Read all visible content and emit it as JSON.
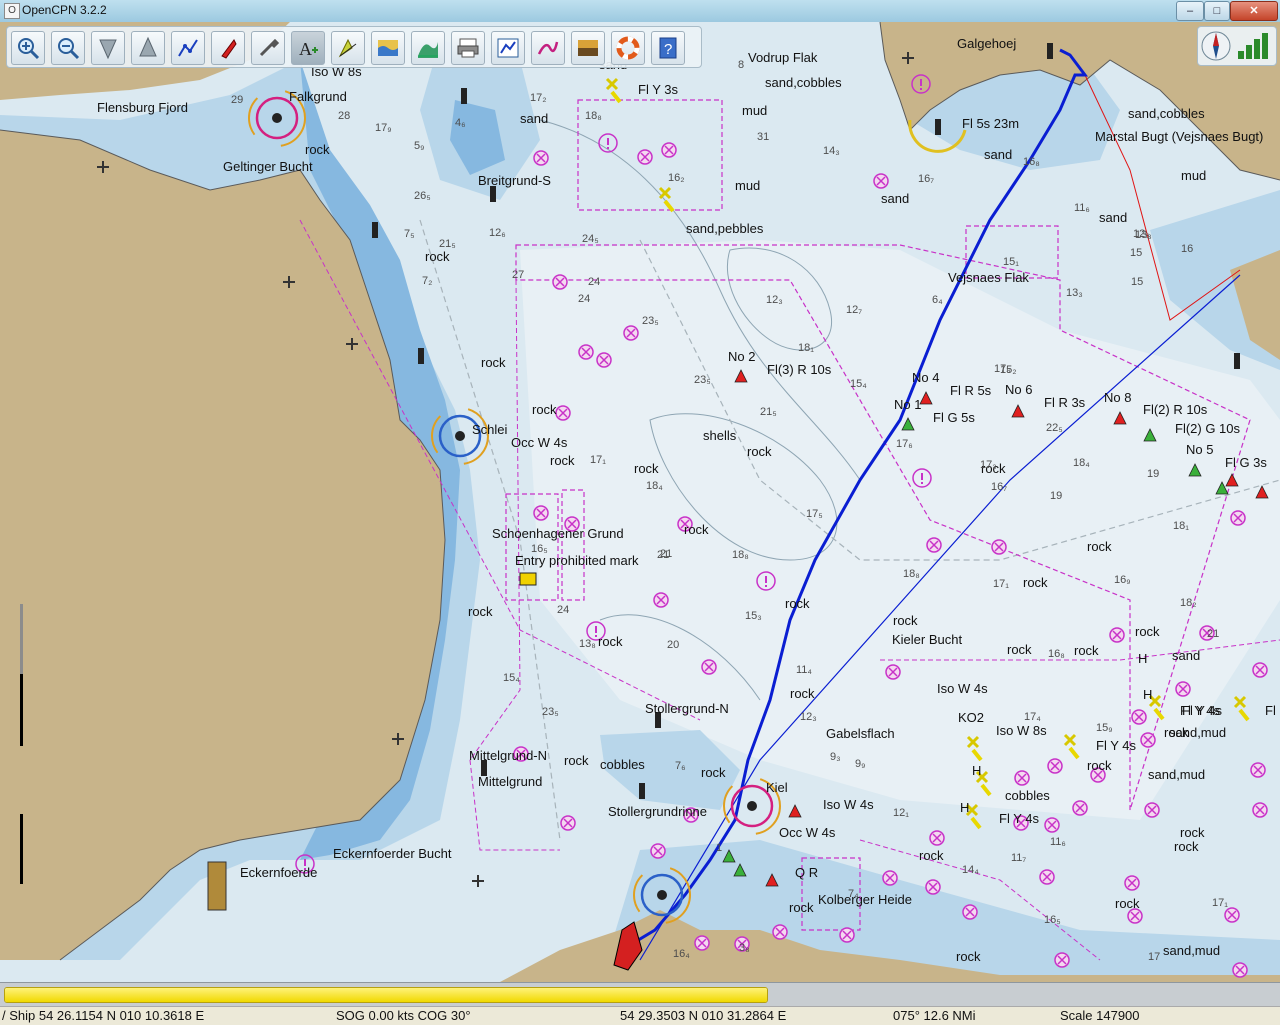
{
  "window": {
    "title": "OpenCPN 3.2.2",
    "min_label": "–",
    "max_label": "□",
    "close_label": "✕"
  },
  "toolbar": {
    "tools": [
      {
        "name": "zoom-in-icon"
      },
      {
        "name": "zoom-out-icon"
      },
      {
        "name": "scale-in-icon"
      },
      {
        "name": "scale-out-icon"
      },
      {
        "name": "route-icon"
      },
      {
        "name": "follow-ship-icon"
      },
      {
        "name": "settings-wrench-icon"
      },
      {
        "name": "text-annotation-icon",
        "active": true
      },
      {
        "name": "current-icon"
      },
      {
        "name": "tide-icon"
      },
      {
        "name": "chart-quilting-icon"
      },
      {
        "name": "print-icon"
      },
      {
        "name": "route-manager-icon"
      },
      {
        "name": "track-icon"
      },
      {
        "name": "color-scheme-icon"
      },
      {
        "name": "mob-lifebuoy-icon"
      },
      {
        "name": "help-icon"
      }
    ]
  },
  "chart": {
    "colors": {
      "land": "#c8b48a",
      "shallow": "#86b8e0",
      "water": "#d8e8f0",
      "deep": "#e6eff4",
      "track": "#0a1ed2",
      "magenta": "#c832c8"
    },
    "labels": [
      {
        "text": "Flensburg Fjord"
      },
      {
        "text": "Iso W 8s"
      },
      {
        "text": "Falkgrund"
      },
      {
        "text": "Geltinger Bucht"
      },
      {
        "text": "rock"
      },
      {
        "text": "sand"
      },
      {
        "text": "Breitgrund-S"
      },
      {
        "text": "Fl Y 3s"
      },
      {
        "text": "sand"
      },
      {
        "text": "mud"
      },
      {
        "text": "mud"
      },
      {
        "text": "sand,pebbles"
      },
      {
        "text": "Vodrup Flak"
      },
      {
        "text": "sand,cobbles"
      },
      {
        "text": "Galgehoej"
      },
      {
        "text": "Fl 5s 23m"
      },
      {
        "text": "sand"
      },
      {
        "text": "sand,cobbles"
      },
      {
        "text": "Marstal Bugt (Vejsnaes Bugt)"
      },
      {
        "text": "mud"
      },
      {
        "text": "sand"
      },
      {
        "text": "sand"
      },
      {
        "text": "Vejsnaes Flak"
      },
      {
        "text": "rock"
      },
      {
        "text": "rock"
      },
      {
        "text": "No 2"
      },
      {
        "text": "Fl(3) R 10s"
      },
      {
        "text": "No 4"
      },
      {
        "text": "Fl R 5s"
      },
      {
        "text": "No 6"
      },
      {
        "text": "Fl R 3s"
      },
      {
        "text": "No 1"
      },
      {
        "text": "Fl G 5s"
      },
      {
        "text": "No 8"
      },
      {
        "text": "Fl(2) R 10s"
      },
      {
        "text": "Fl(2) G 10s"
      },
      {
        "text": "No 5"
      },
      {
        "text": "Fl G 3s"
      },
      {
        "text": "Schlei"
      },
      {
        "text": "Occ W 4s"
      },
      {
        "text": "rock"
      },
      {
        "text": "rock"
      },
      {
        "text": "shells"
      },
      {
        "text": "rock"
      },
      {
        "text": "rock"
      },
      {
        "text": "rock"
      },
      {
        "text": "rock"
      },
      {
        "text": "Schoenhagener Grund"
      },
      {
        "text": "Entry prohibited mark"
      },
      {
        "text": "rock"
      },
      {
        "text": "rock"
      },
      {
        "text": "rock"
      },
      {
        "text": "rock"
      },
      {
        "text": "rock"
      },
      {
        "text": "rock"
      },
      {
        "text": "rock"
      },
      {
        "text": "rock"
      },
      {
        "text": "Kieler Bucht"
      },
      {
        "text": "rock"
      },
      {
        "text": "rock"
      },
      {
        "text": "sand"
      },
      {
        "text": "Iso W 4s"
      },
      {
        "text": "sand,mud"
      },
      {
        "text": "rock"
      },
      {
        "text": "Stollergrund-N"
      },
      {
        "text": "Gabelsflach"
      },
      {
        "text": "KO2"
      },
      {
        "text": "Iso W 8s"
      },
      {
        "text": "Fl Y 4s"
      },
      {
        "text": "Fl Y 4s"
      },
      {
        "text": "rock"
      },
      {
        "text": "sand,mud"
      },
      {
        "text": "Mittelgrund-N"
      },
      {
        "text": "Mittelgrund"
      },
      {
        "text": "rock"
      },
      {
        "text": "cobbles"
      },
      {
        "text": "rock"
      },
      {
        "text": "Kiel"
      },
      {
        "text": "Iso W 4s"
      },
      {
        "text": "Occ W 4s"
      },
      {
        "text": "Stollergrundrinne"
      },
      {
        "text": "cobbles"
      },
      {
        "text": "Fl Y 4s"
      },
      {
        "text": "rock"
      },
      {
        "text": "Eckernfoerder Bucht"
      },
      {
        "text": "Eckernfoerde"
      },
      {
        "text": "Q R"
      },
      {
        "text": "Kolberger Heide"
      },
      {
        "text": "rock"
      },
      {
        "text": "rock"
      },
      {
        "text": "rock"
      },
      {
        "text": "sand,mud"
      },
      {
        "text": "H"
      },
      {
        "text": "H"
      },
      {
        "text": "H"
      },
      {
        "text": "H"
      },
      {
        "text": "Fl"
      },
      {
        "text": "Fl Y 4s"
      },
      {
        "text": "rock"
      },
      {
        "text": "rock"
      }
    ],
    "depths": [
      {
        "text": "29"
      },
      {
        "text": "28"
      },
      {
        "text": "17₂"
      },
      {
        "text": "17₉"
      },
      {
        "text": "5₉"
      },
      {
        "text": "4₆"
      },
      {
        "text": "26₅"
      },
      {
        "text": "12₆"
      },
      {
        "text": "7₅"
      },
      {
        "text": "21₅"
      },
      {
        "text": "7₂"
      },
      {
        "text": "18₈"
      },
      {
        "text": "16₂"
      },
      {
        "text": "24₅"
      },
      {
        "text": "31"
      },
      {
        "text": "8"
      },
      {
        "text": "14₃"
      },
      {
        "text": "16₇"
      },
      {
        "text": "16₈"
      },
      {
        "text": "11₆"
      },
      {
        "text": "12₆"
      },
      {
        "text": "13₃"
      },
      {
        "text": "16"
      },
      {
        "text": "15"
      },
      {
        "text": "13₃"
      },
      {
        "text": "6₄"
      },
      {
        "text": "15₁"
      },
      {
        "text": "27"
      },
      {
        "text": "24"
      },
      {
        "text": "24"
      },
      {
        "text": "23₅"
      },
      {
        "text": "12₃"
      },
      {
        "text": "12₇"
      },
      {
        "text": "18₁"
      },
      {
        "text": "15₄"
      },
      {
        "text": "23₅"
      },
      {
        "text": "21₅"
      },
      {
        "text": "15₂"
      },
      {
        "text": "17₆"
      },
      {
        "text": "17₃"
      },
      {
        "text": "21"
      },
      {
        "text": "17₁"
      },
      {
        "text": "18₄"
      },
      {
        "text": "17₅"
      },
      {
        "text": "17₆"
      },
      {
        "text": "22₅"
      },
      {
        "text": "18₄"
      },
      {
        "text": "16₇"
      },
      {
        "text": "19"
      },
      {
        "text": "19"
      },
      {
        "text": "18₁"
      },
      {
        "text": "16₅"
      },
      {
        "text": "21"
      },
      {
        "text": "18₈"
      },
      {
        "text": "15₃"
      },
      {
        "text": "24"
      },
      {
        "text": "13₈"
      },
      {
        "text": "20"
      },
      {
        "text": "15₄"
      },
      {
        "text": "23₅"
      },
      {
        "text": "11₄"
      },
      {
        "text": "12₃"
      },
      {
        "text": "18₈"
      },
      {
        "text": "17₁"
      },
      {
        "text": "16₉"
      },
      {
        "text": "18₂"
      },
      {
        "text": "16₈"
      },
      {
        "text": "17₄"
      },
      {
        "text": "15₉"
      },
      {
        "text": "7₆"
      },
      {
        "text": "9₃"
      },
      {
        "text": "9₉"
      },
      {
        "text": "12₁"
      },
      {
        "text": "11₆"
      },
      {
        "text": "11₇"
      },
      {
        "text": "14₄"
      },
      {
        "text": "16₅"
      },
      {
        "text": "17₁"
      },
      {
        "text": "21"
      },
      {
        "text": "16₄"
      },
      {
        "text": "3₈"
      },
      {
        "text": "7₄"
      },
      {
        "text": "17"
      },
      {
        "text": "15"
      },
      {
        "text": "1"
      }
    ]
  },
  "progress": {
    "fraction": 0.595
  },
  "status": {
    "ship": "/ Ship 54 26.1154 N   010 10.3618 E",
    "sog_cog": "SOG 0.00 kts   COG 30°",
    "cursor": "54 29.3503 N   010 31.2864 E",
    "bearing": "075°   12.6 NMi",
    "scale": "Scale 147900"
  }
}
